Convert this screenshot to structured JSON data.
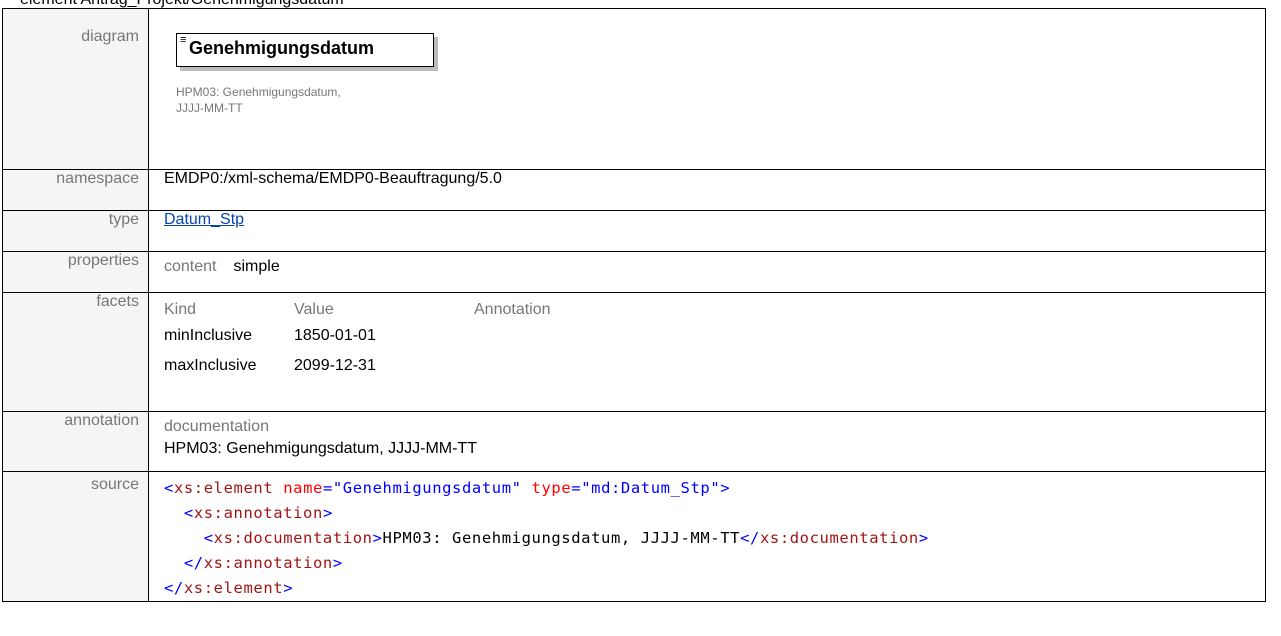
{
  "heading": "element Antrag_Projekt/Genehmigungsdatum",
  "labels": {
    "diagram": "diagram",
    "namespace": "namespace",
    "type": "type",
    "properties": "properties",
    "facets": "facets",
    "annotation": "annotation",
    "source": "source"
  },
  "diagram": {
    "element_name": "Genehmigungsdatum",
    "doc_line1": "HPM03: Genehmigungsdatum,",
    "doc_line2": "JJJJ-MM-TT"
  },
  "namespace": "EMDP0:/xml-schema/EMDP0-Beauftragung/5.0",
  "type": {
    "link_text": "Datum_Stp"
  },
  "properties": {
    "key": "content",
    "value": "simple"
  },
  "facets": {
    "headers": [
      "Kind",
      "Value",
      "Annotation"
    ],
    "rows": [
      {
        "kind": "minInclusive",
        "value": "1850-01-01",
        "annotation": ""
      },
      {
        "kind": "maxInclusive",
        "value": "2099-12-31",
        "annotation": ""
      }
    ]
  },
  "annotation": {
    "key": "documentation",
    "value": "HPM03: Genehmigungsdatum, JJJJ-MM-TT"
  },
  "source": {
    "l1_open": "<",
    "l1_tag": "xs:element",
    "l1_attr1": "name",
    "l1_eq1": "=",
    "l1_val1": "\"Genehmigungsdatum\"",
    "l1_attr2": "type",
    "l1_eq2": "=",
    "l1_val2": "\"md:Datum_Stp\"",
    "l1_close": ">",
    "l2_open": "<",
    "l2_tag": "xs:annotation",
    "l2_close": ">",
    "l3_open": "<",
    "l3_tag": "xs:documentation",
    "l3_close": ">",
    "l3_text": "HPM03: Genehmigungsdatum, JJJJ-MM-TT",
    "l3_end_open": "</",
    "l3_end_tag": "xs:documentation",
    "l3_end_close": ">",
    "l4_open": "</",
    "l4_tag": "xs:annotation",
    "l4_close": ">",
    "l5_open": "</",
    "l5_tag": "xs:element",
    "l5_close": ">"
  }
}
